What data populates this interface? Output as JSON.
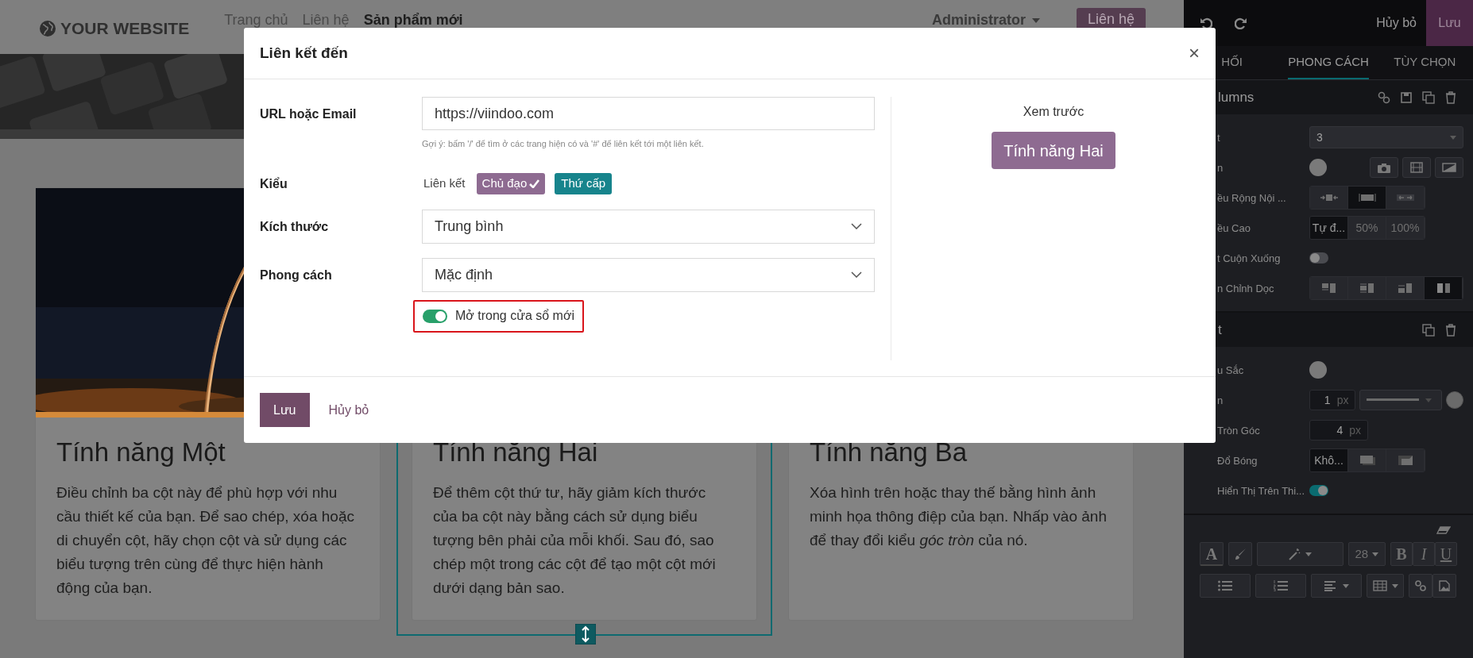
{
  "site_header": {
    "logo": "YOUR WEBSITE",
    "nav": [
      {
        "label": "Trang chủ",
        "selected": false
      },
      {
        "label": "Liên hệ",
        "selected": false
      },
      {
        "label": "Sản phẩm mới",
        "selected": true
      }
    ],
    "user": "Administrator",
    "cta": "Liên hệ"
  },
  "cards": [
    {
      "title": "Tính năng Một",
      "body": "Điều chỉnh ba cột này để phù hợp với nhu cầu thiết kế của bạn. Để sao chép, xóa hoặc di chuyển cột, hãy chọn cột và sử dụng các biểu tượng trên cùng để thực hiện hành động của bạn.",
      "selected": false
    },
    {
      "title": "Tính năng Hai",
      "body": "Để thêm cột thứ tư, hãy giảm kích thước của ba cột này bằng cách sử dụng biểu tượng bên phải của mỗi khối. Sau đó, sao chép một trong các cột để tạo một cột mới dưới dạng bản sao.",
      "selected": true
    },
    {
      "title": "Tính năng Ba",
      "body": "Xóa hình trên hoặc thay thế bằng hình ảnh minh họa thông điệp của bạn. Nhấp vào ảnh để thay đổi kiểu *góc tròn* của nó.",
      "selected": false
    }
  ],
  "modal": {
    "title": "Liên kết đến",
    "close": "×",
    "url": {
      "label": "URL hoặc Email",
      "value": "https://viindoo.com",
      "hint": "Gợi ý: bấm '/' để tìm ở các trang hiện có và '#' để liên kết tới một liên kết."
    },
    "type": {
      "label": "Kiểu",
      "options": [
        {
          "label": "Liên kết",
          "kind": "link",
          "selected": false
        },
        {
          "label": "Chủ đạo",
          "kind": "primary",
          "selected": true
        },
        {
          "label": "Thứ cấp",
          "kind": "secondary",
          "selected": false
        }
      ]
    },
    "size": {
      "label": "Kích thước",
      "value": "Trung bình"
    },
    "style": {
      "label": "Phong cách",
      "value": "Mặc định"
    },
    "new_window": {
      "label": "Mở trong cửa sổ mới",
      "on": true,
      "highlighted": true
    },
    "preview": {
      "label": "Xem trước",
      "button": "Tính năng Hai"
    },
    "save": "Lưu",
    "cancel": "Hủy bỏ"
  },
  "editor_panel": {
    "cancel": "Hủy bỏ",
    "save": "Lưu",
    "tabs": [
      {
        "label": "HỐI",
        "selected": false
      },
      {
        "label": "PHONG CÁCH",
        "selected": true
      },
      {
        "label": "TÙY CHỌN",
        "selected": false
      }
    ],
    "sections": [
      {
        "title": "lumns",
        "kind": "block",
        "rows": [
          {
            "label": "t",
            "kind": "select",
            "value": "3"
          },
          {
            "label": "n",
            "kind": "background"
          },
          {
            "label": "ều Rộng Nội ...",
            "kind": "width",
            "options": [
              {
                "selected": false
              },
              {
                "selected": true
              },
              {
                "selected": false
              }
            ]
          },
          {
            "label": "ều Cao",
            "kind": "height",
            "options": [
              {
                "label": "Tự đ...",
                "selected": true
              },
              {
                "label": "50%",
                "selected": false
              },
              {
                "label": "100%",
                "selected": false
              }
            ]
          },
          {
            "label": "t Cuộn Xuống",
            "kind": "toggle",
            "on": false
          },
          {
            "label": "n Chỉnh Dọc",
            "kind": "align",
            "options": [
              {
                "selected": false
              },
              {
                "selected": false
              },
              {
                "selected": false
              },
              {
                "selected": true
              }
            ]
          }
        ]
      },
      {
        "title": "t",
        "kind": "column",
        "rows": [
          {
            "label": "u Sắc",
            "kind": "color"
          },
          {
            "label": "n",
            "kind": "border",
            "value": "1",
            "unit": "px"
          },
          {
            "label": "Tròn Góc",
            "kind": "number",
            "value": "4",
            "unit": "px"
          },
          {
            "label": "Đổ Bóng",
            "kind": "shadow",
            "options": [
              {
                "label": "Khô...",
                "selected": true
              },
              {
                "selected": false
              },
              {
                "selected": false
              }
            ]
          },
          {
            "label": "Hiển Thị Trên Thi...",
            "kind": "toggle",
            "on": true
          }
        ]
      }
    ],
    "toolbar": {
      "color_letter": "A",
      "font_size": "28",
      "formats": [
        "B",
        "I",
        "U"
      ]
    }
  }
}
